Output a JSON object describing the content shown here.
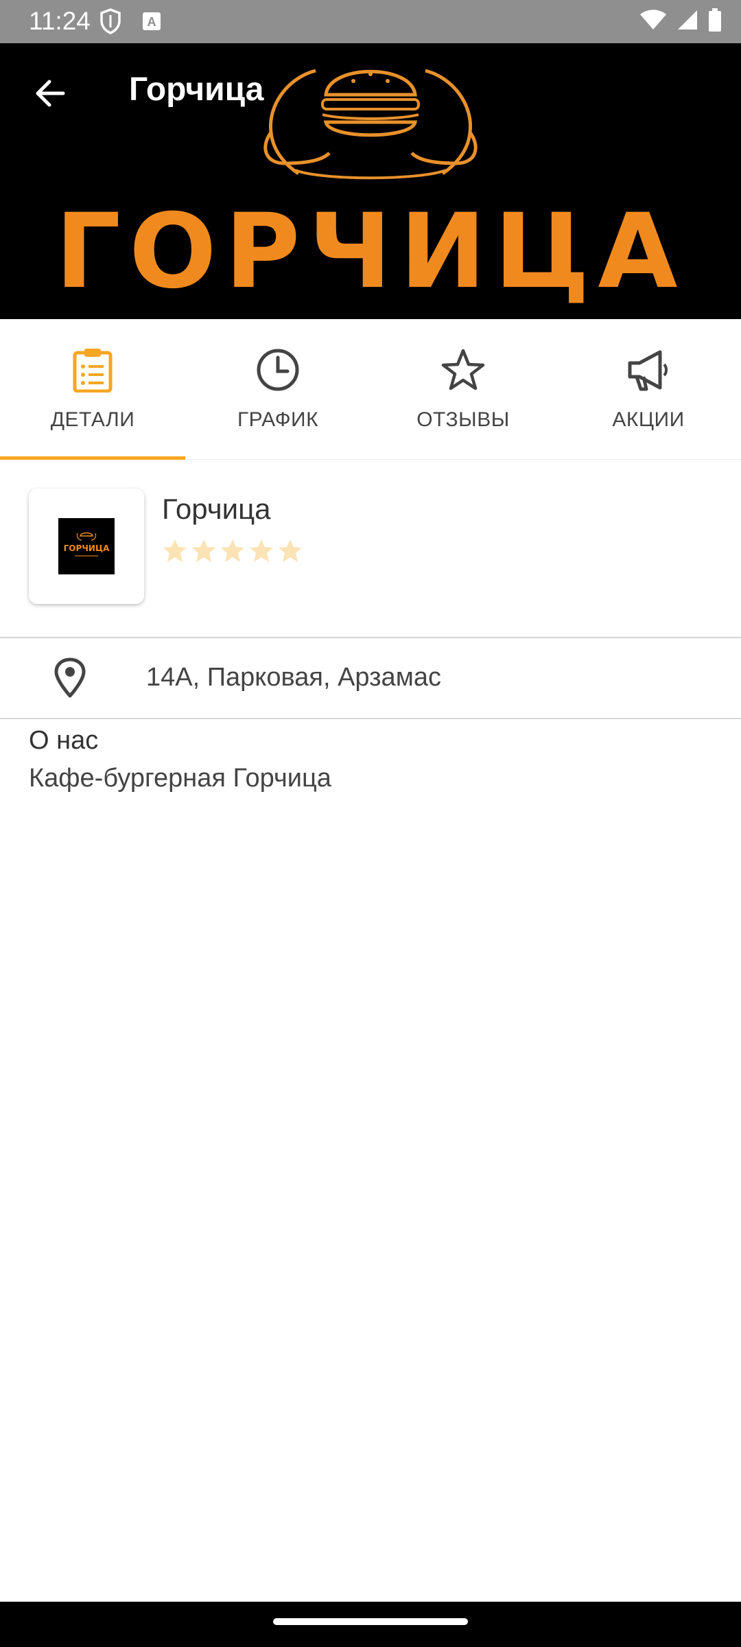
{
  "status_bar": {
    "time": "11:24"
  },
  "header": {
    "title": "Горчица",
    "brand_logo_text": "ГОРЧИЦА"
  },
  "tabs": [
    {
      "label": "ДЕТАЛИ",
      "icon": "clipboard-icon",
      "active": true
    },
    {
      "label": "ГРАФИК",
      "icon": "clock-icon",
      "active": false
    },
    {
      "label": "ОТЗЫВЫ",
      "icon": "star-outline-icon",
      "active": false
    },
    {
      "label": "АКЦИИ",
      "icon": "megaphone-icon",
      "active": false
    }
  ],
  "place": {
    "name": "Горчица",
    "rating": 0,
    "rating_max": 5
  },
  "address": {
    "text": "14А, Парковая, Арзамас",
    "icon": "location-pin-icon"
  },
  "about": {
    "title": "О нас",
    "text": "Кафе-бургерная Горчица"
  },
  "colors": {
    "accent": "#f5a623",
    "header_bg": "#000000",
    "status_bar_bg": "#8f8f8f",
    "star_inactive": "#fbe3b5"
  }
}
